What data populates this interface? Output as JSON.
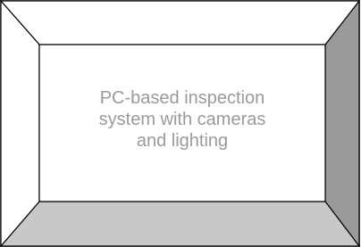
{
  "diagram": {
    "box_label": "PC-based inspection\nsystem with cameras\nand lighting",
    "colors": {
      "outline": "#000000",
      "face_fill": "#ffffff",
      "right_bevel": "#9a9a9a",
      "bottom_bevel": "#c8c8c8",
      "text": "#9a9a9a"
    }
  }
}
